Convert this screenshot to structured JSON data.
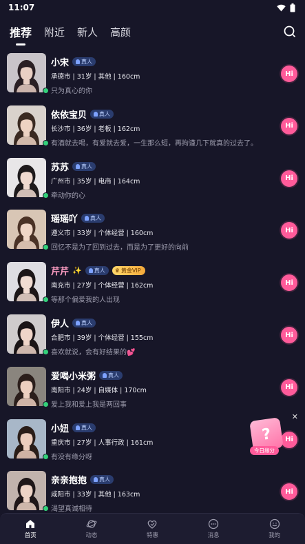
{
  "status": {
    "time": "11:07"
  },
  "tabs": [
    {
      "label": "推荐",
      "active": true
    },
    {
      "label": "附近",
      "active": false
    },
    {
      "label": "新人",
      "active": false
    },
    {
      "label": "高颜",
      "active": false
    }
  ],
  "badges": {
    "real": "真人",
    "vip": "黄金VIP"
  },
  "hi_label": "Hi",
  "users": [
    {
      "name": "小宋",
      "vip": false,
      "info": "承德市 | 31岁 | 其他 | 160cm",
      "sig": "只为真心的你",
      "hair": "#2a1f24",
      "skin": "#e9cfc4",
      "bg": "#c9c4c9"
    },
    {
      "name": "依依宝贝",
      "vip": false,
      "info": "长沙市 | 36岁 | 老板 | 162cm",
      "sig": "有酒就去喝，有爱就去爱，一生那么短，再拘谨几下就真的过去了。",
      "hair": "#3a2a22",
      "skin": "#edd2c2",
      "bg": "#d9d2cc"
    },
    {
      "name": "苏苏",
      "vip": false,
      "info": "广州市 | 35岁 | 电商 | 164cm",
      "sig": "牵动你的心",
      "hair": "#1e1a1c",
      "skin": "#f0dad0",
      "bg": "#e8e6e8"
    },
    {
      "name": "瑶瑶吖",
      "vip": false,
      "info": "遵义市 | 33岁 | 个体经营 | 160cm",
      "sig": "回忆不是为了回到过去，而是为了更好的向前",
      "hair": "#4a3226",
      "skin": "#efd6c6",
      "bg": "#d8c6b5"
    },
    {
      "name": "芹芹",
      "vip": true,
      "info": "南充市 | 27岁 | 个体经营 | 162cm",
      "sig": "等那个偏爱我的人出现",
      "hair": "#1c1618",
      "skin": "#f1dcd2",
      "bg": "#dedde2"
    },
    {
      "name": "伊人",
      "vip": false,
      "info": "合肥市 | 39岁 | 个体经营 | 155cm",
      "sig": "喜欢就说，会有好结果的💕",
      "hair": "#1a1416",
      "skin": "#efd4c8",
      "bg": "#cfcbcc"
    },
    {
      "name": "爱喝小米粥",
      "vip": false,
      "info": "南阳市 | 24岁 | 自媒体 | 170cm",
      "sig": "爱上我和爱上我是两回事",
      "hair": "#2b1e1b",
      "skin": "#eccfc0",
      "bg": "#8a857e"
    },
    {
      "name": "小妞",
      "vip": false,
      "info": "重庆市 | 27岁 | 人事行政 | 161cm",
      "sig": "有没有缘分呀",
      "hair": "#2a1d18",
      "skin": "#eccdbd",
      "bg": "#a8b7c8"
    },
    {
      "name": "亲亲抱抱",
      "vip": false,
      "info": "咸阳市 | 33岁 | 其他 | 163cm",
      "sig": "渴望真诚相待",
      "hair": "#1f1719",
      "skin": "#edd3c6",
      "bg": "#c1b3ad"
    }
  ],
  "floating": {
    "label": "今日缘分",
    "glyph": "?"
  },
  "nav": [
    {
      "label": "首页",
      "icon": "home-icon",
      "active": true
    },
    {
      "label": "动态",
      "icon": "planet-icon",
      "active": false
    },
    {
      "label": "特惠",
      "icon": "heart-gift-icon",
      "active": false
    },
    {
      "label": "消息",
      "icon": "chat-icon",
      "active": false
    },
    {
      "label": "我的",
      "icon": "profile-icon",
      "active": false
    }
  ],
  "colors": {
    "background": "#171628",
    "accent": "#ff5b9a",
    "online": "#33d17a"
  }
}
